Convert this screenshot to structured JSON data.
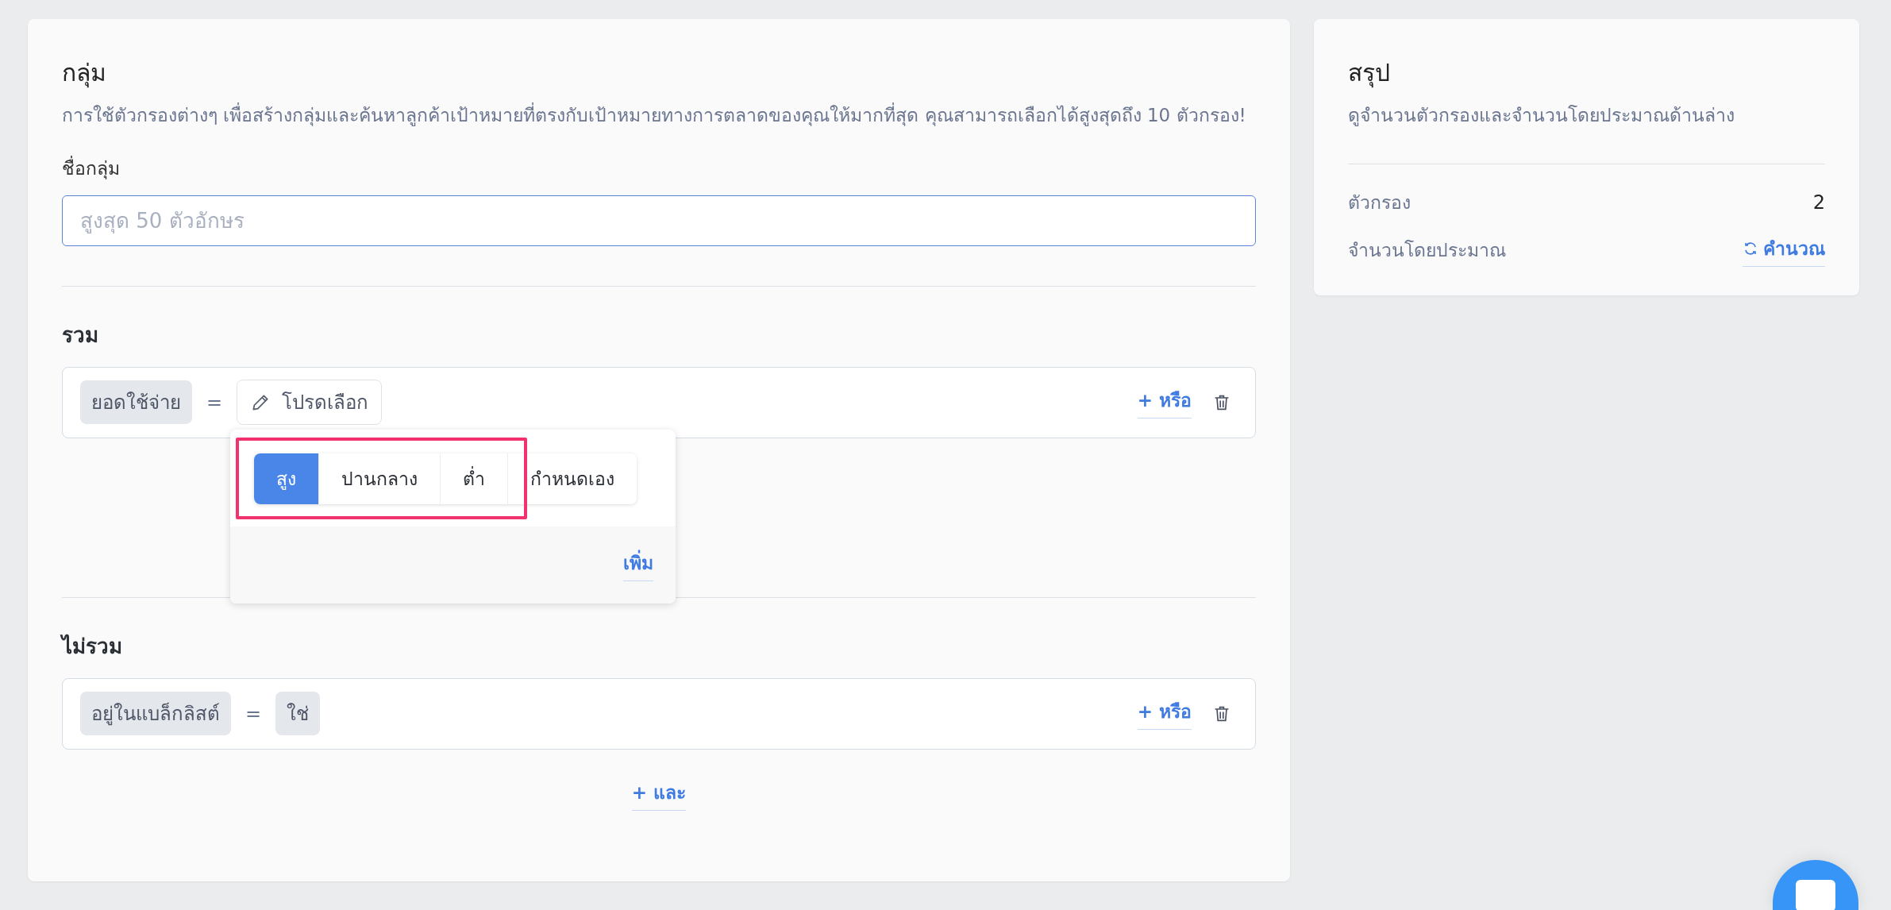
{
  "group": {
    "title": "กลุ่ม",
    "description": "การใช้ตัวกรองต่างๆ เพื่อสร้างกลุ่มและค้นหาลูกค้าเป้าหมายที่ตรงกับเป้าหมายทางการตลาดของคุณให้มากที่สุด คุณสามารถเลือกได้สูงสุดถึง 10 ตัวกรอง!",
    "name_field": {
      "label": "ชื่อกลุ่ม",
      "placeholder": "สูงสุด 50 ตัวอักษร"
    }
  },
  "include": {
    "heading": "รวม",
    "rules": [
      {
        "field": "ยอดใช้จ่าย",
        "operator": "=",
        "value": "โปรดเลือก",
        "kind": "picker",
        "or_link": "+ หรือ"
      }
    ],
    "popover": {
      "highlighted": true,
      "options": [
        {
          "label": "สูง",
          "selected": true
        },
        {
          "label": "ปานกลาง",
          "selected": false
        },
        {
          "label": "ต่ำ",
          "selected": false
        },
        {
          "label": "กำหนดเอง",
          "selected": false
        }
      ],
      "add_link": "เพิ่ม"
    }
  },
  "exclude": {
    "heading": "ไม่รวม",
    "rules": [
      {
        "field": "อยู่ในแบล็กลิสต์",
        "operator": "=",
        "value": "ใช่",
        "kind": "chip",
        "or_link": "+ หรือ"
      }
    ],
    "and_link": "+ และ"
  },
  "summary": {
    "title": "สรุป",
    "description": "ดูจำนวนตัวกรองและจำนวนโดยประมาณด้านล่าง",
    "rows": [
      {
        "label": "ตัวกรอง",
        "value": "2",
        "kind": "text"
      },
      {
        "label": "จำนวนโดยประมาณ",
        "value": "คำนวณ",
        "kind": "action"
      }
    ]
  }
}
